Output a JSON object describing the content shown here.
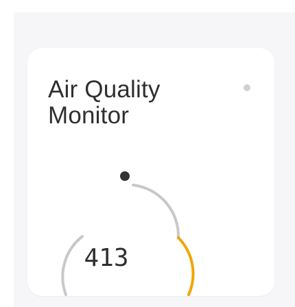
{
  "card": {
    "title": "Air Quality Monitor",
    "status_color": "#d0d0d4"
  },
  "gauge": {
    "value": "413",
    "arc_color_normal": "#c8c8c8",
    "arc_color_alert": "#f2a500",
    "marker_color": "#333333"
  }
}
